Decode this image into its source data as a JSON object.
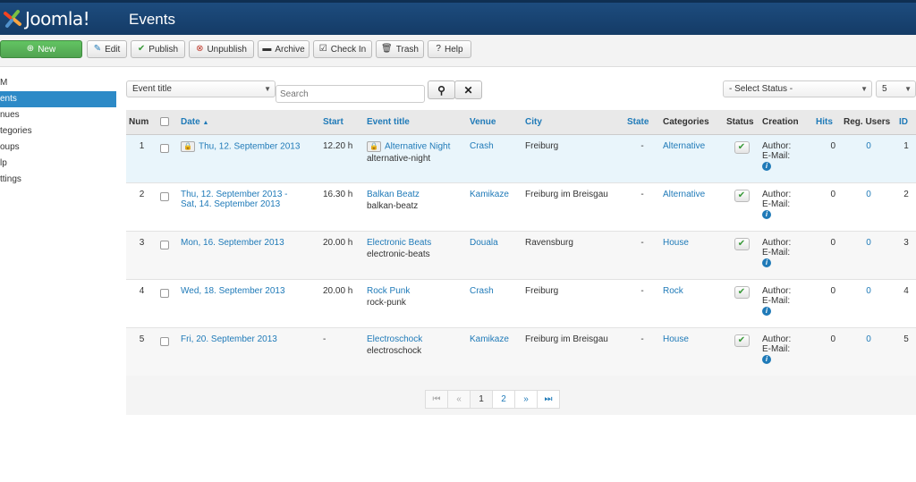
{
  "header": {
    "logo_text": "Joomla!",
    "title": "Events"
  },
  "toolbar": {
    "new": "New",
    "edit": "Edit",
    "publish": "Publish",
    "unpublish": "Unpublish",
    "archive": "Archive",
    "checkin": "Check In",
    "trash": "Trash",
    "help": "Help"
  },
  "sidebar": {
    "items": [
      "M",
      "ents",
      "nues",
      "tegories",
      "oups",
      "lp",
      "ttings"
    ]
  },
  "filters": {
    "field_select": "Event title",
    "search_placeholder": "Search",
    "status_select": "- Select Status -",
    "limit_select": "5"
  },
  "table": {
    "headers": {
      "num": "Num",
      "date": "Date",
      "start": "Start",
      "title": "Event title",
      "venue": "Venue",
      "city": "City",
      "state": "State",
      "categories": "Categories",
      "status": "Status",
      "creation": "Creation",
      "hits": "Hits",
      "reg_users": "Reg. Users",
      "id": "ID"
    },
    "rows": [
      {
        "num": "1",
        "date1": "Thu, 12. September 2013",
        "date2": "",
        "start": "12.20 h",
        "title": "Alternative Night",
        "alias": "alternative-night",
        "venue": "Crash",
        "city": "Freiburg",
        "state": "-",
        "category": "Alternative",
        "author": "Author:",
        "email": "E-Mail:",
        "hits": "0",
        "reg": "0",
        "id": "1"
      },
      {
        "num": "2",
        "date1": "Thu, 12. September 2013 -",
        "date2": "Sat, 14. September 2013",
        "start": "16.30 h",
        "title": "Balkan Beatz",
        "alias": "balkan-beatz",
        "venue": "Kamikaze",
        "city": "Freiburg im Breisgau",
        "state": "-",
        "category": "Alternative",
        "author": "Author:",
        "email": "E-Mail:",
        "hits": "0",
        "reg": "0",
        "id": "2"
      },
      {
        "num": "3",
        "date1": "Mon, 16. September 2013",
        "date2": "",
        "start": "20.00 h",
        "title": "Electronic Beats",
        "alias": "electronic-beats",
        "venue": "Douala",
        "city": "Ravensburg",
        "state": "-",
        "category": "House",
        "author": "Author:",
        "email": "E-Mail:",
        "hits": "0",
        "reg": "0",
        "id": "3"
      },
      {
        "num": "4",
        "date1": "Wed, 18. September 2013",
        "date2": "",
        "start": "20.00 h",
        "title": "Rock Punk",
        "alias": "rock-punk",
        "venue": "Crash",
        "city": "Freiburg",
        "state": "-",
        "category": "Rock",
        "author": "Author:",
        "email": "E-Mail:",
        "hits": "0",
        "reg": "0",
        "id": "4"
      },
      {
        "num": "5",
        "date1": "Fri, 20. September 2013",
        "date2": "",
        "start": "-",
        "title": "Electroschock",
        "alias": "electroschock",
        "venue": "Kamikaze",
        "city": "Freiburg im Breisgau",
        "state": "-",
        "category": "House",
        "author": "Author:",
        "email": "E-Mail:",
        "hits": "0",
        "reg": "0",
        "id": "5"
      }
    ]
  },
  "pagination": {
    "page1": "1",
    "page2": "2"
  },
  "colors": {
    "header": "#1d4c7e",
    "accent": "#2d8ac7",
    "link": "#1f7ab8",
    "new_button": "#51a351"
  }
}
